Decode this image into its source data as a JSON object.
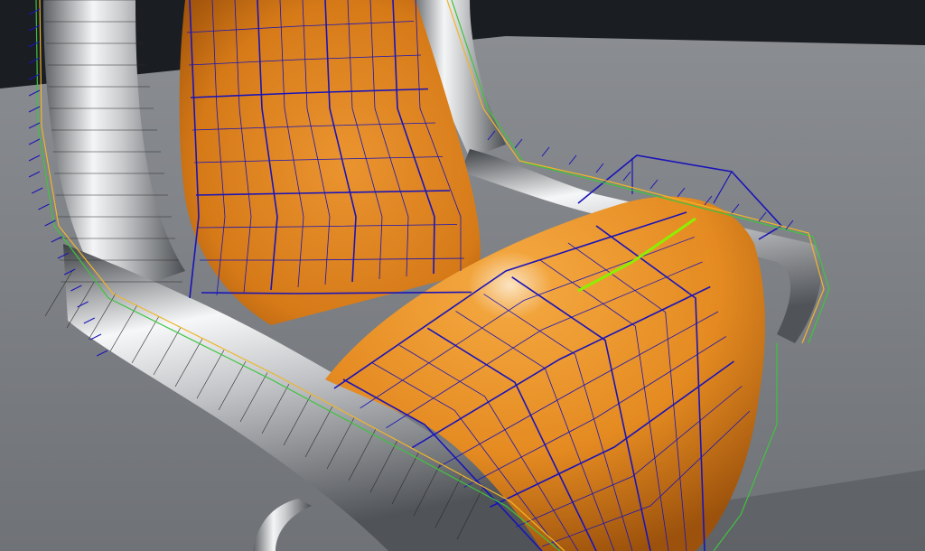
{
  "viewport": {
    "view_mode": "wireframe-overlay",
    "scene_object": "armchair",
    "icon": "mesh-wireframe-icon"
  },
  "colors": {
    "sky": "#1a1d22",
    "floor": "#7c7f84",
    "floor_far": "#8a8d91",
    "cushion": "#e48a21",
    "cushion_shadow": "#b55f0e",
    "cushion_highlight": "#f6b85a",
    "chrome": "#d7d9db",
    "chrome_dark": "#6d7074",
    "chrome_highlight": "#ffffff",
    "wire_primary": "#1a14b8",
    "wire_secondary": "#2c2c2c",
    "outline_green": "#3ec43e",
    "outline_yellow": "#f0b52a",
    "selected_edge": "#8cf000"
  }
}
